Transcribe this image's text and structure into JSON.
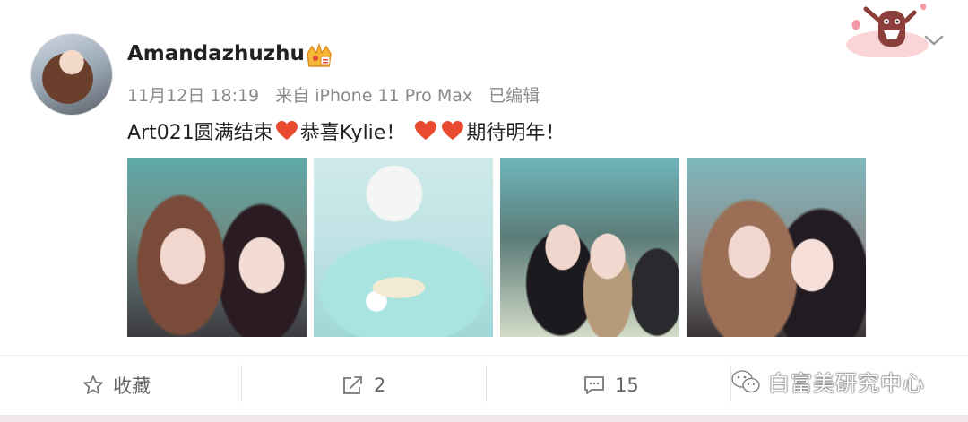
{
  "post": {
    "username": "Amandazhuzhu",
    "date": "11月12日 18:19",
    "source": "来自 iPhone 11 Pro Max",
    "edited": "已编辑",
    "text_part1": "Art021圆满结束",
    "text_part2": " 恭喜Kylie！",
    "text_part3": "期待明年！",
    "icons": {
      "avatar": "avatar",
      "badge": "vip-crown-icon",
      "decoration": "cartoon-monster-sticker-icon",
      "more": "chevron-down-icon",
      "heart": "red-heart-icon"
    },
    "photos": [
      {
        "name": "photo-1"
      },
      {
        "name": "photo-2"
      },
      {
        "name": "photo-3"
      },
      {
        "name": "photo-4"
      }
    ]
  },
  "actions": {
    "favorite_label": "收藏",
    "repost_count": "2",
    "comment_count": "15",
    "icons": [
      "star-icon",
      "share-icon",
      "comment-icon",
      "like-icon"
    ]
  },
  "watermark": {
    "text": "白富美研究中心",
    "icon": "wechat-icon"
  },
  "colors": {
    "heart": "#e8492f",
    "meta_text": "#8a8a8a",
    "action_text": "#666666",
    "bottom_bar": "#f3e6e9"
  }
}
